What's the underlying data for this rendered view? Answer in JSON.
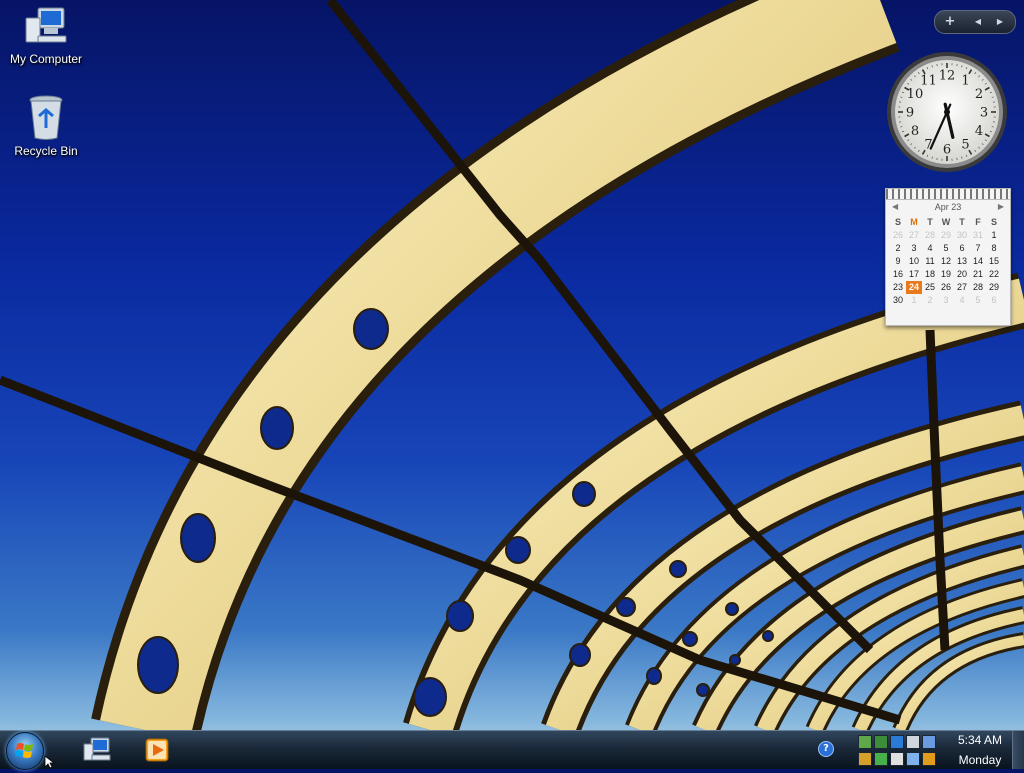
{
  "desktop": {
    "icons": [
      {
        "label": "My Computer",
        "icon": "computer-icon"
      },
      {
        "label": "Recycle Bin",
        "icon": "recycle-bin-icon"
      }
    ]
  },
  "sidebar": {
    "add_button": "+",
    "prev_button": "◀",
    "next_button": "▶"
  },
  "clock_gadget": {
    "numbers": [
      "12",
      "1",
      "2",
      "3",
      "4",
      "5",
      "6",
      "7",
      "8",
      "9",
      "10",
      "11"
    ],
    "time": "5:34"
  },
  "calendar_gadget": {
    "month": "Apr 23",
    "weekdays": [
      "S",
      "M",
      "T",
      "W",
      "T",
      "F",
      "S"
    ],
    "today_weekday_index": 1,
    "weeks": [
      [
        {
          "d": "26",
          "o": true
        },
        {
          "d": "27",
          "o": true
        },
        {
          "d": "28",
          "o": true
        },
        {
          "d": "29",
          "o": true
        },
        {
          "d": "30",
          "o": true
        },
        {
          "d": "31",
          "o": true
        },
        {
          "d": "1"
        }
      ],
      [
        {
          "d": "2"
        },
        {
          "d": "3"
        },
        {
          "d": "4"
        },
        {
          "d": "5"
        },
        {
          "d": "6"
        },
        {
          "d": "7"
        },
        {
          "d": "8"
        }
      ],
      [
        {
          "d": "9"
        },
        {
          "d": "10"
        },
        {
          "d": "11"
        },
        {
          "d": "12"
        },
        {
          "d": "13"
        },
        {
          "d": "14"
        },
        {
          "d": "15"
        }
      ],
      [
        {
          "d": "16"
        },
        {
          "d": "17"
        },
        {
          "d": "18"
        },
        {
          "d": "19"
        },
        {
          "d": "20"
        },
        {
          "d": "21"
        },
        {
          "d": "22"
        }
      ],
      [
        {
          "d": "23"
        },
        {
          "d": "24",
          "today": true
        },
        {
          "d": "25"
        },
        {
          "d": "26"
        },
        {
          "d": "27"
        },
        {
          "d": "28"
        },
        {
          "d": "29"
        }
      ],
      [
        {
          "d": "30"
        },
        {
          "d": "1",
          "o": true
        },
        {
          "d": "2",
          "o": true
        },
        {
          "d": "3",
          "o": true
        },
        {
          "d": "4",
          "o": true
        },
        {
          "d": "5",
          "o": true
        },
        {
          "d": "6",
          "o": true
        }
      ]
    ]
  },
  "taskbar": {
    "start_icon": "windows-start-icon",
    "quick_launch": [
      {
        "name": "show-desktop",
        "icon": "desktop-computer-icon"
      },
      {
        "name": "media-player",
        "icon": "media-player-icon"
      }
    ],
    "help_icon": "help-icon",
    "tray_icons": [
      "network-icon",
      "security-icon",
      "volume-icon",
      "display-icon",
      "safely-remove-icon",
      "update-icon",
      "power-icon",
      "language-icon",
      "monitor-icon",
      "search-icon"
    ],
    "clock_time": "5:34 AM",
    "clock_day": "Monday"
  },
  "colors": {
    "sky_top": "#061466",
    "sky_bottom": "#86b8de",
    "bridge": "#f0e3a6",
    "calendar_today": "#e87a1c",
    "taskbar": "#1a2838"
  }
}
